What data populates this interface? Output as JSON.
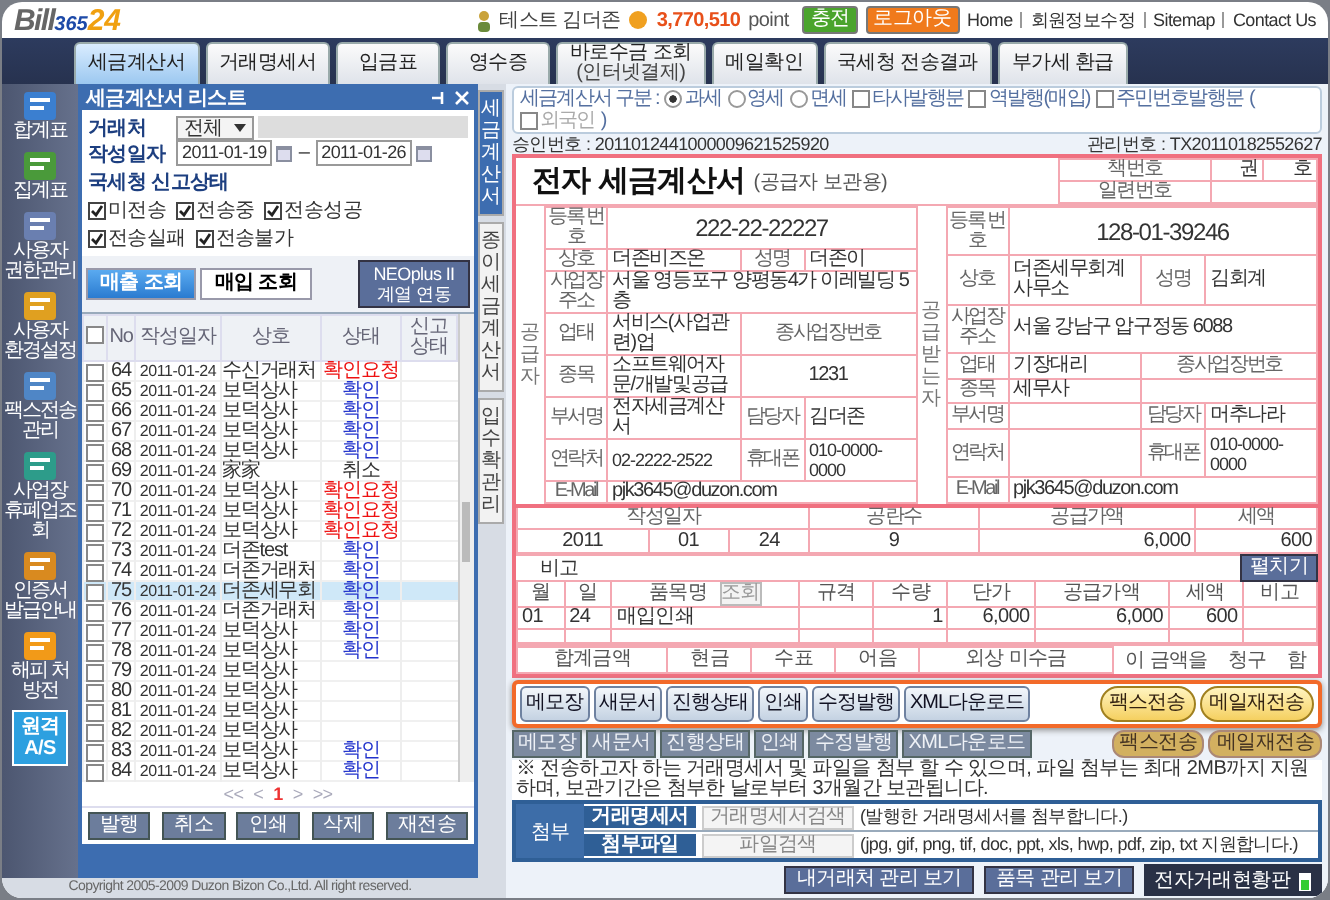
{
  "header": {
    "logo": [
      "Bill",
      "365",
      "24"
    ],
    "user": "테스트 김더존",
    "points": "3,770,510",
    "points_unit": "point",
    "buttons": [
      {
        "label": "충전",
        "kind": "charge"
      },
      {
        "label": "로그아웃",
        "kind": "logout"
      }
    ],
    "links": [
      "Home",
      "회원정보수정",
      "Sitemap",
      "Contact Us"
    ]
  },
  "nav_tabs": [
    {
      "label": "세금계산서",
      "selected": true
    },
    {
      "label": "거래명세서",
      "selected": false
    },
    {
      "label": "입금표",
      "selected": false
    },
    {
      "label": "영수증",
      "selected": false
    },
    {
      "label": "바로수금 조회",
      "sub": "(인터넷결제)",
      "selected": false
    },
    {
      "label": "메일확인",
      "selected": false
    },
    {
      "label": "국세청 전송결과",
      "selected": false
    },
    {
      "label": "부가세 환급",
      "selected": false
    }
  ],
  "sidebar": [
    {
      "label": "합계표",
      "kind": "icon"
    },
    {
      "label": "집계표",
      "kind": "icon"
    },
    {
      "label": "사용자 권한관리",
      "kind": "icon"
    },
    {
      "label": "사용자 환경설정",
      "kind": "icon"
    },
    {
      "label": "팩스전송 관리",
      "kind": "icon"
    },
    {
      "label": "사업장 휴폐업조회",
      "kind": "icon"
    },
    {
      "label": "인증서 발급안내",
      "kind": "icon"
    },
    {
      "label": "해피 처방전",
      "kind": "icon"
    },
    {
      "label": "원격 A/S",
      "kind": "tile"
    }
  ],
  "list": {
    "title": "세금계산서 리스트",
    "partner_label": "거래처",
    "partner_select": "전체",
    "date_label": "작성일자",
    "date_from": "2011-01-19",
    "date_sep": "–",
    "date_to": "2011-01-26",
    "status_label": "국세청 신고상태",
    "status_checks": [
      {
        "label": "미전송",
        "checked": true
      },
      {
        "label": "전송중",
        "checked": true
      },
      {
        "label": "전송성공",
        "checked": true
      },
      {
        "label": "전송실패",
        "checked": true
      },
      {
        "label": "전송불가",
        "checked": true
      }
    ],
    "modes": [
      {
        "label": "매출 조회",
        "selected": true
      },
      {
        "label": "매입 조회",
        "selected": false
      }
    ],
    "link_button": "NEOplus II 계열 연동",
    "all_checked": false,
    "columns": [
      "No",
      "작성일자",
      "상호",
      "상태",
      "신고상태"
    ],
    "rows": [
      {
        "no": "64",
        "date": "2011-01-24",
        "company": "수신거래처",
        "status": "확인요청",
        "color": "#ee1111",
        "checked": false,
        "selected": false
      },
      {
        "no": "65",
        "date": "2011-01-24",
        "company": "보덕상사",
        "status": "확인",
        "color": "#2233cc",
        "checked": false,
        "selected": false
      },
      {
        "no": "66",
        "date": "2011-01-24",
        "company": "보덕상사",
        "status": "확인",
        "color": "#2233cc",
        "checked": false,
        "selected": false
      },
      {
        "no": "67",
        "date": "2011-01-24",
        "company": "보덕상사",
        "status": "확인",
        "color": "#2233cc",
        "checked": false,
        "selected": false
      },
      {
        "no": "68",
        "date": "2011-01-24",
        "company": "보덕상사",
        "status": "확인",
        "color": "#2233cc",
        "checked": false,
        "selected": false
      },
      {
        "no": "69",
        "date": "2011-01-24",
        "company": "家家",
        "status": "취소",
        "color": "#333333",
        "checked": false,
        "selected": false
      },
      {
        "no": "70",
        "date": "2011-01-24",
        "company": "보덕상사",
        "status": "확인요청",
        "color": "#ee1111",
        "checked": false,
        "selected": false
      },
      {
        "no": "71",
        "date": "2011-01-24",
        "company": "보덕상사",
        "status": "확인요청",
        "color": "#ee1111",
        "checked": false,
        "selected": false
      },
      {
        "no": "72",
        "date": "2011-01-24",
        "company": "보덕상사",
        "status": "확인요청",
        "color": "#ee1111",
        "checked": false,
        "selected": false
      },
      {
        "no": "73",
        "date": "2011-01-24",
        "company": "더존test",
        "status": "확인",
        "color": "#2233cc",
        "checked": false,
        "selected": false
      },
      {
        "no": "74",
        "date": "2011-01-24",
        "company": "더존거래처",
        "status": "확인",
        "color": "#2233cc",
        "checked": false,
        "selected": false
      },
      {
        "no": "75",
        "date": "2011-01-24",
        "company": "더존세무회",
        "status": "확인",
        "color": "#2233cc",
        "checked": false,
        "selected": true
      },
      {
        "no": "76",
        "date": "2011-01-24",
        "company": "더존거래처",
        "status": "확인",
        "color": "#2233cc",
        "checked": false,
        "selected": false
      },
      {
        "no": "77",
        "date": "2011-01-24",
        "company": "보덕상사",
        "status": "확인",
        "color": "#2233cc",
        "checked": false,
        "selected": false
      },
      {
        "no": "78",
        "date": "2011-01-24",
        "company": "보덕상사",
        "status": "확인",
        "color": "#2233cc",
        "checked": false,
        "selected": false
      },
      {
        "no": "79",
        "date": "2011-01-24",
        "company": "보덕상사",
        "checked": false,
        "selected": false
      },
      {
        "no": "80",
        "date": "2011-01-24",
        "company": "보덕상사",
        "checked": false,
        "selected": false
      },
      {
        "no": "81",
        "date": "2011-01-24",
        "company": "보덕상사",
        "checked": false,
        "selected": false
      },
      {
        "no": "82",
        "date": "2011-01-24",
        "company": "보덕상사",
        "checked": false,
        "selected": false
      },
      {
        "no": "83",
        "date": "2011-01-24",
        "company": "보덕상사",
        "status": "확인",
        "color": "#2233cc",
        "checked": false,
        "selected": false
      },
      {
        "no": "84",
        "date": "2011-01-24",
        "company": "보덕상사",
        "status": "확인",
        "color": "#2233cc",
        "checked": false,
        "selected": false
      }
    ],
    "pager": {
      "first": "<<",
      "prev": "<",
      "pages": [
        {
          "label": "1",
          "selected": true
        }
      ],
      "next": ">",
      "last": ">>"
    },
    "actions": [
      "발행",
      "취소",
      "인쇄",
      "삭제",
      "재전송"
    ]
  },
  "copyright": "Copyright 2005-2009 Duzon Bizon Co.,Ltd. All right reserved.",
  "invoice": {
    "side_tabs": [
      {
        "label": "세금계산서",
        "selected": true
      },
      {
        "label": "종이세금계산서",
        "selected": false
      },
      {
        "label": "입수확관리",
        "selected": false
      }
    ],
    "type_label": "세금계산서 구분 :",
    "tax_types": [
      {
        "label": "과세",
        "selected": true
      },
      {
        "label": "영세",
        "selected": false
      },
      {
        "label": "면세",
        "selected": false
      }
    ],
    "options": [
      {
        "label": "타사발행분",
        "checked": false
      },
      {
        "label": "역발행(매입)",
        "checked": false
      },
      {
        "label": "주민번호발행분",
        "checked": false
      }
    ],
    "foreign": {
      "open": "(",
      "label": "외국인",
      "checked": false,
      "close": ")"
    },
    "approval_label": "승인번호 :",
    "approval_no": "2011012441000009621525920",
    "management_label": "관리번호 :",
    "management_no": "TX20110182552627",
    "title": "전자 세금계산서",
    "subtitle": "(공급자 보관용)",
    "book_label": "책번호",
    "book_vol": "권",
    "book_no": "호",
    "serial_label": "일련번호",
    "parties": [
      {
        "side": "공급자",
        "reg_label": "등록 번호",
        "reg_no": "222-22-22227",
        "name_label": "상호",
        "name": "더존비즈온",
        "rep_label": "성명",
        "rep": "더존이",
        "addr_label": "사업장 주소",
        "addr": "서울 영등포구 양평동4가 이레빌딩 5층",
        "biz_label": "업태",
        "biz": "서비스(사업관련)업",
        "branch_label": "종사업장번호",
        "item_label": "종목",
        "item": "소프트웨어자문/개발및공급",
        "branch": "1231",
        "dept_label": "부서명",
        "dept": "전자세금계산서",
        "person_label": "담당자",
        "person": "김더존",
        "tel_label": "연락처",
        "tel": "02-2222-2522",
        "mobile_label": "휴대폰",
        "mobile": "010-0000-0000",
        "email_label": "E-Mail",
        "email": "pjk3645@duzon.com"
      },
      {
        "side": "공급받는자",
        "reg_label": "등록 번호",
        "reg_no": "128-01-39246",
        "name_label": "상호",
        "name": "더존세무회계사무소",
        "rep_label": "성명",
        "rep": "김회계",
        "addr_label": "사업장 주소",
        "addr": "서울 강남구 압구정동 6088",
        "biz_label": "업태",
        "biz": "기장대리",
        "branch_label": "종사업장번호",
        "item_label": "종목",
        "item": "세무사",
        "dept_label": "부서명",
        "person_label": "담당자",
        "person": "머추나라",
        "tel_label": "연락처",
        "mobile_label": "휴대폰",
        "mobile": "010-0000-0000",
        "email_label": "E-Mail",
        "email": "pjk3645@duzon.com"
      }
    ],
    "summary_columns": [
      "작성일자",
      "공란수",
      "공급가액",
      "세액"
    ],
    "summary": {
      "year": "2011",
      "month": "01",
      "day": "24",
      "blanks": "9",
      "supply": "6,000",
      "tax": "600"
    },
    "note_label": "비고",
    "expand_button": "펼치기",
    "item_columns": [
      "월",
      "일",
      "품목명",
      "규격",
      "수량",
      "단가",
      "공급가액",
      "세액",
      "비고"
    ],
    "lookup_button": "조회",
    "items": [
      {
        "month": "01",
        "day": "24",
        "name": "매입인쇄",
        "qty": "1",
        "price": "6,000",
        "supply": "6,000",
        "tax": "600"
      }
    ],
    "total_columns": [
      "합계금액",
      "현금",
      "수표",
      "어음",
      "외상 미수금"
    ],
    "claim": [
      "이 금액을",
      "청구",
      "함"
    ],
    "popup_left": [
      "메모장",
      "새문서",
      "진행상태",
      "인쇄",
      "수정발행",
      "XML다운로드"
    ],
    "popup_right": [
      "팩스전송",
      "메일재전송"
    ],
    "small_left": [
      "메모장",
      "새문서",
      "진행상태",
      "인쇄",
      "수정발행",
      "XML다운로드"
    ],
    "small_right": [
      "팩스전송",
      "메일재전송"
    ],
    "notice": "※ 전송하고자 하는 거래명세서 및 파일을 첨부 할 수 있으며, 파일 첨부는 최대 2MB까지 지원하며, 보관기간은 첨부한 날로부터 3개월간 보관됩니다.",
    "attach_label": "첨부",
    "attachments": [
      {
        "label": "거래명세서",
        "button": "거래명세서검색",
        "note": "(발행한 거래명세서를 첨부합니다.)"
      },
      {
        "label": "첨부파일",
        "button": "파일검색",
        "note": "(jpg, gif, png, tif, doc, ppt, xls, hwp, pdf, zip, txt 지원합니다.)"
      }
    ],
    "footer_buttons": [
      "내거래처 관리 보기",
      "품목 관리 보기"
    ],
    "dashboard": "전자거래현황판"
  }
}
